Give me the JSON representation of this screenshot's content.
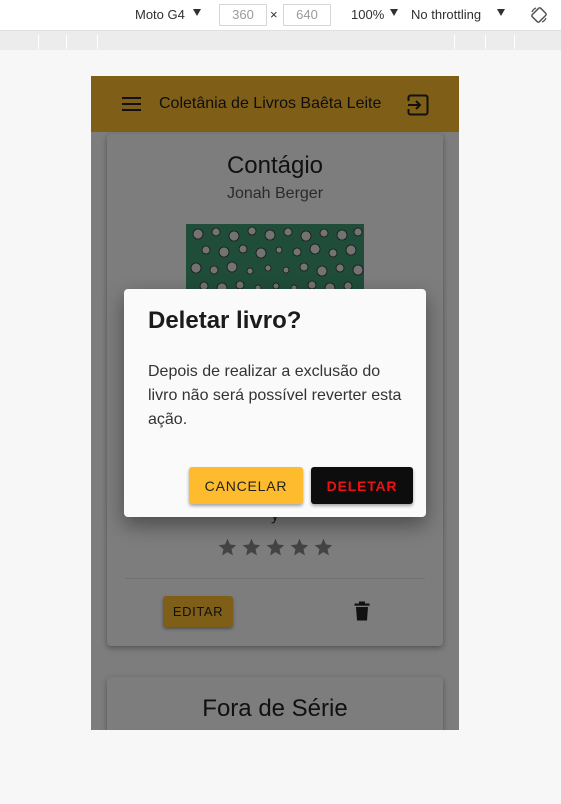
{
  "devtools": {
    "device": "Moto G4",
    "width": "360",
    "height": "640",
    "times": "×",
    "zoom": "100%",
    "throttling": "No throttling"
  },
  "app": {
    "title": "Coletânia de Livros Baêta Leite",
    "accent_color": "#ffbd2e"
  },
  "books": [
    {
      "title": "Contágio",
      "author": "Jonah Berger",
      "cover_subtitle": "y",
      "rating": 0,
      "max_rating": 5,
      "edit_label": "EDITAR"
    },
    {
      "title": "Fora de Série"
    }
  ],
  "dialog": {
    "title": "Deletar livro?",
    "body": "Depois de realizar a exclusão do livro não será possível reverter esta ação.",
    "cancel_label": "CANCELAR",
    "delete_label": "DELETAR"
  },
  "icons": {
    "menu": "menu-icon",
    "logout": "logout-icon",
    "trash": "trash-icon",
    "star": "star-icon",
    "rotate": "rotate-icon"
  }
}
